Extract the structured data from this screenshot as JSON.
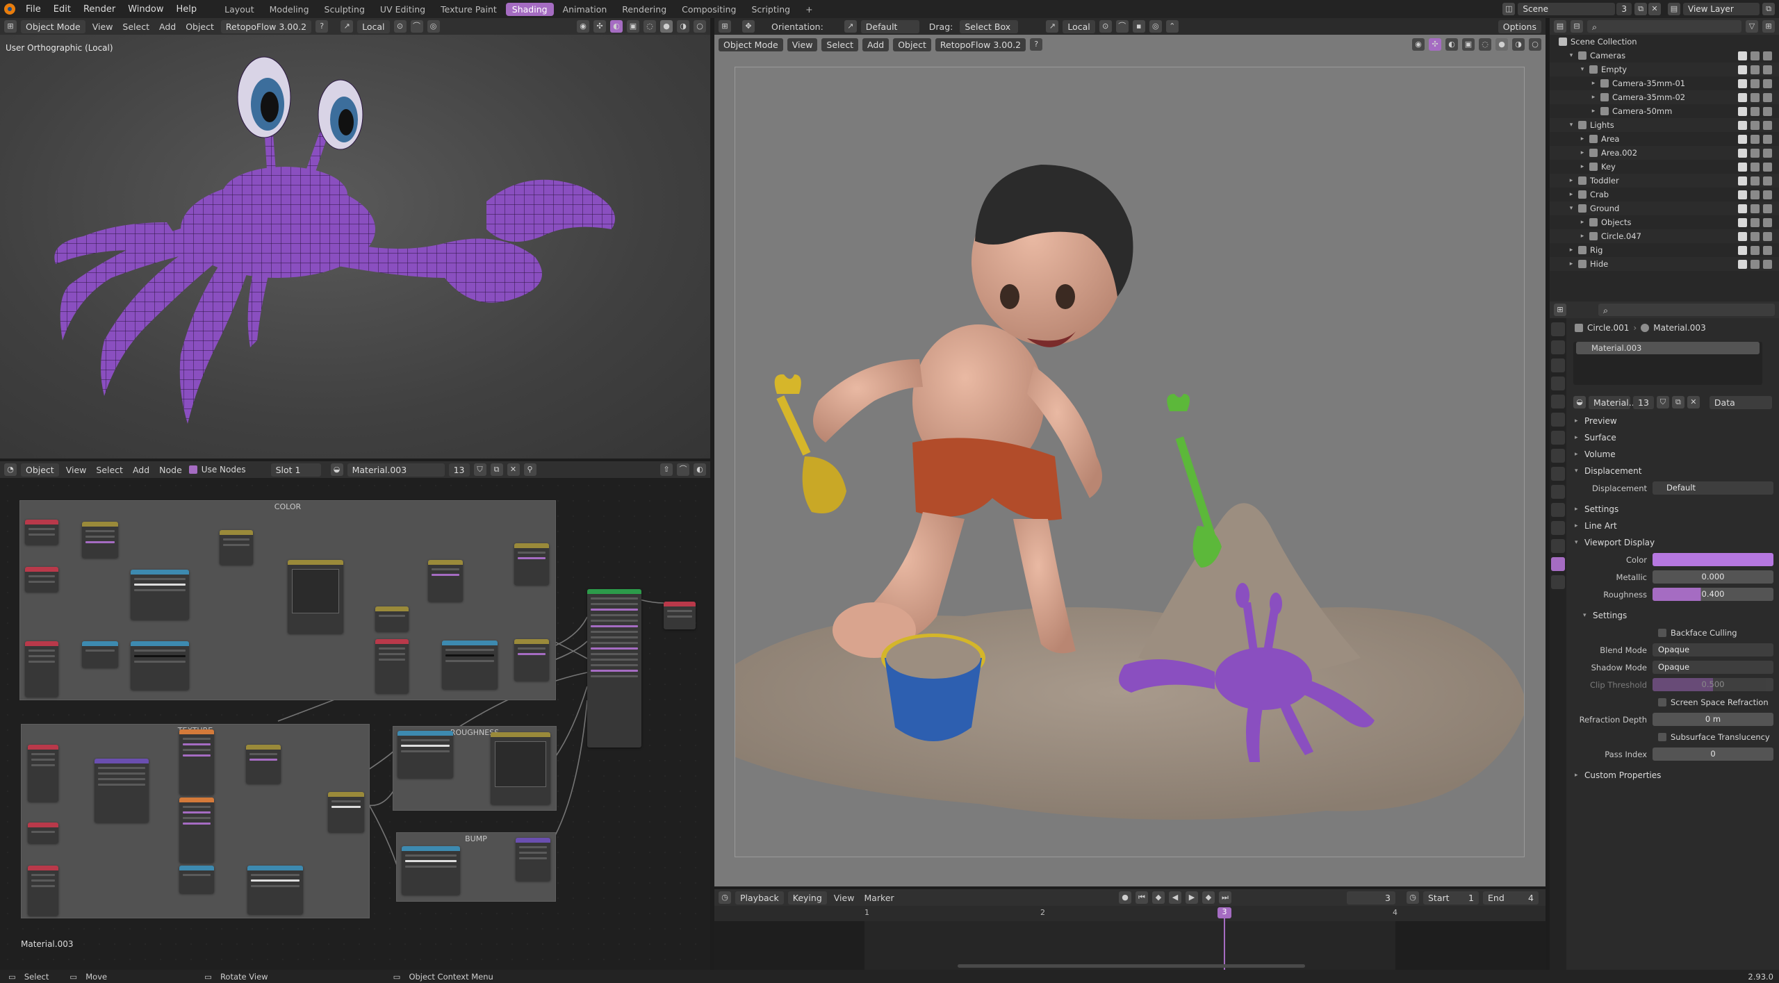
{
  "topbar": {
    "menus": [
      "File",
      "Edit",
      "Render",
      "Window",
      "Help"
    ],
    "workspaces": [
      "Layout",
      "Modeling",
      "Sculpting",
      "UV Editing",
      "Texture Paint",
      "Shading",
      "Animation",
      "Rendering",
      "Compositing",
      "Scripting"
    ],
    "active_workspace": "Shading",
    "add_tab": "+",
    "scene": "Scene",
    "scene_users": "3",
    "view_layer": "View Layer"
  },
  "left_viewport": {
    "mode": "Object Mode",
    "menus": [
      "View",
      "Select",
      "Add",
      "Object"
    ],
    "addon": "RetopoFlow 3.00.2",
    "orientation": "Local",
    "view_label": "User Orthographic (Local)"
  },
  "node_editor": {
    "editor_type": "Object",
    "menus": [
      "View",
      "Select",
      "Add",
      "Node"
    ],
    "use_nodes_label": "Use Nodes",
    "slot": "Slot 1",
    "material": "Material.003",
    "material_users": "13",
    "frames": {
      "color": "COLOR",
      "texture": "TEXTURE",
      "roughness": "ROUGHNESS",
      "bump": "BUMP"
    },
    "footer_material": "Material.003"
  },
  "right_viewport": {
    "orientation_label": "Orientation:",
    "orientation_value": "Default",
    "drag_label": "Drag:",
    "drag_value": "Select Box",
    "transform_space": "Local",
    "options": "Options",
    "mode": "Object Mode",
    "menus": [
      "View",
      "Select",
      "Add",
      "Object"
    ],
    "addon": "RetopoFlow 3.00.2"
  },
  "timeline": {
    "menus": [
      "Playback",
      "Keying",
      "View",
      "Marker"
    ],
    "current_frame": "3",
    "start_label": "Start",
    "start": "1",
    "end_label": "End",
    "end": "4",
    "ticks": [
      "1",
      "2",
      "3",
      "4"
    ]
  },
  "outliner": {
    "root": "Scene Collection",
    "rows": [
      {
        "label": "Cameras",
        "depth": 1,
        "expanded": "▾"
      },
      {
        "label": "Empty",
        "depth": 2,
        "expanded": "▾"
      },
      {
        "label": "Camera-35mm-01",
        "depth": 3,
        "expanded": "▸"
      },
      {
        "label": "Camera-35mm-02",
        "depth": 3,
        "expanded": "▸"
      },
      {
        "label": "Camera-50mm",
        "depth": 3,
        "expanded": "▸"
      },
      {
        "label": "Lights",
        "depth": 1,
        "expanded": "▾"
      },
      {
        "label": "Area",
        "depth": 2,
        "expanded": "▸"
      },
      {
        "label": "Area.002",
        "depth": 2,
        "expanded": "▸"
      },
      {
        "label": "Key",
        "depth": 2,
        "expanded": "▸"
      },
      {
        "label": "Toddler",
        "depth": 1,
        "expanded": "▸"
      },
      {
        "label": "Crab",
        "depth": 1,
        "expanded": "▸"
      },
      {
        "label": "Ground",
        "depth": 1,
        "expanded": "▾"
      },
      {
        "label": "Objects",
        "depth": 2,
        "expanded": "▸"
      },
      {
        "label": "Circle.047",
        "depth": 2,
        "expanded": "▸"
      },
      {
        "label": "Rig",
        "depth": 1,
        "expanded": "▸"
      },
      {
        "label": "Hide",
        "depth": 1,
        "expanded": "▸"
      }
    ]
  },
  "properties": {
    "object": "Circle.001",
    "material": "Material.003",
    "slot_item": "Material.003",
    "material_short": "Material...",
    "material_users": "13",
    "link": "Data",
    "sections": {
      "preview": "Preview",
      "surface": "Surface",
      "volume": "Volume",
      "displacement": "Displacement",
      "settings": "Settings",
      "line_art": "Line Art",
      "viewport_display": "Viewport Display",
      "vd_settings": "Settings",
      "custom": "Custom Properties"
    },
    "displacement_label": "Displacement",
    "displacement_value": "Default",
    "color_label": "Color",
    "metallic_label": "Metallic",
    "metallic": "0.000",
    "roughness_label": "Roughness",
    "roughness": "0.400",
    "roughness_fraction": 0.4,
    "backface_culling": "Backface Culling",
    "blend_mode_label": "Blend Mode",
    "blend_mode": "Opaque",
    "shadow_mode_label": "Shadow Mode",
    "shadow_mode": "Opaque",
    "clip_label": "Clip Threshold",
    "clip": "0.500",
    "ssr": "Screen Space Refraction",
    "refraction_label": "Refraction Depth",
    "refraction": "0 m",
    "subsurface": "Subsurface Translucency",
    "pass_label": "Pass Index",
    "pass": "0"
  },
  "statusbar": {
    "select": "Select",
    "move": "Move",
    "rotate": "Rotate View",
    "context": "Object Context Menu",
    "version": "2.93.0"
  },
  "colors": {
    "accent": "#a56cc2",
    "viewport_color": "#b678e0",
    "crab": "#8a4fc0",
    "playhead": "#a56cc2"
  }
}
